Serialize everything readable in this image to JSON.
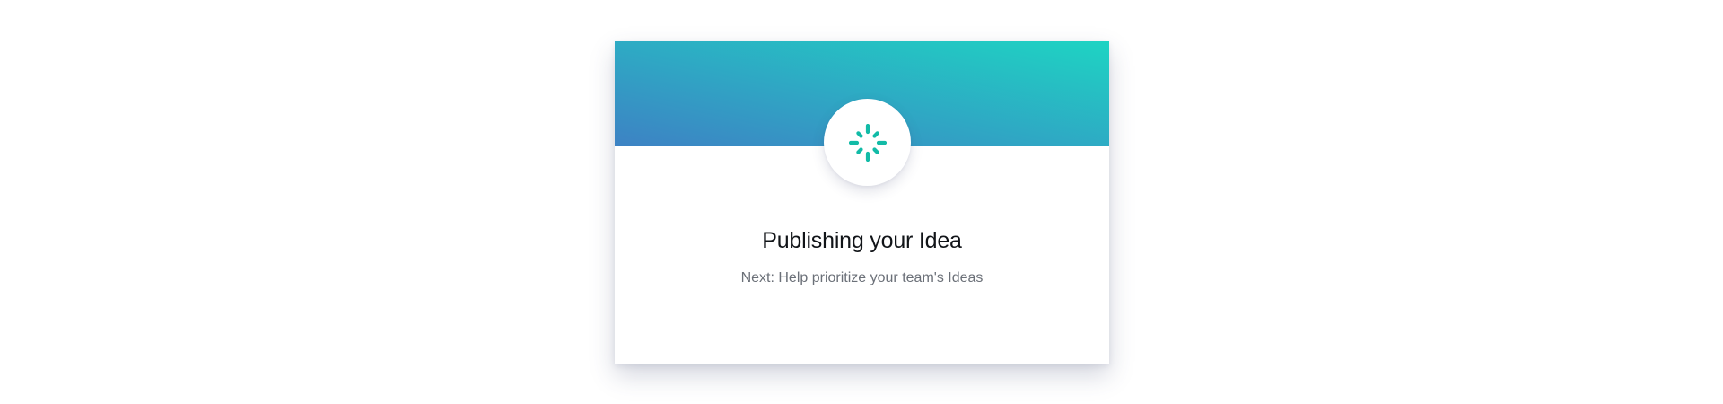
{
  "modal": {
    "title": "Publishing your Idea",
    "subtitle": "Next: Help prioritize your team's Ideas"
  },
  "icons": {
    "status": "loading-spinner-icon"
  },
  "colors": {
    "gradient_start": "#3d82c4",
    "gradient_end": "#1ed4c3",
    "spinner": "#12bba7",
    "title_text": "#111418",
    "subtitle_text": "#6b7078"
  }
}
